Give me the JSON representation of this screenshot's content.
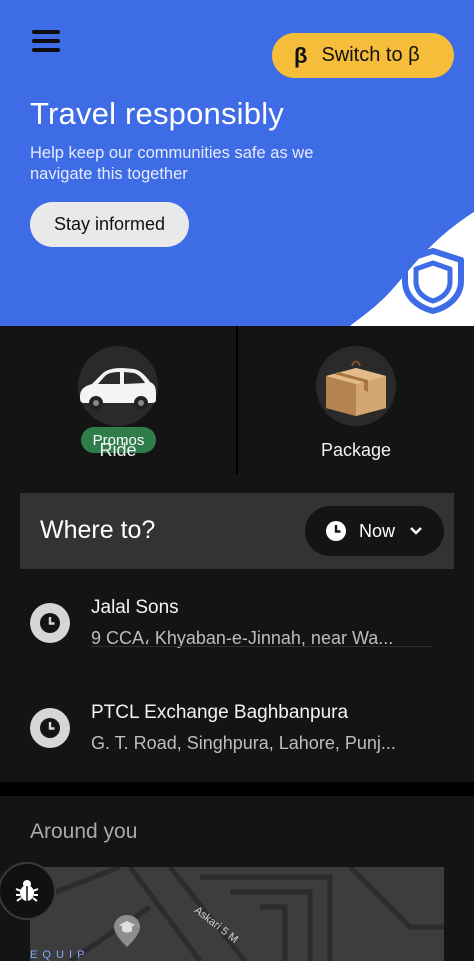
{
  "banner": {
    "switch_label": "Switch to β",
    "switch_icon_glyph": "β",
    "title": "Travel responsibly",
    "subtitle": "Help keep our communities safe as we navigate this together",
    "cta_label": "Stay informed",
    "bg_color": "#3e6be6",
    "accent_color": "#f6bd3b"
  },
  "services": [
    {
      "label": "Ride",
      "badge": "Promos",
      "icon": "car-icon"
    },
    {
      "label": "Package",
      "icon": "package-icon"
    }
  ],
  "where_to": {
    "label": "Where to?",
    "schedule_label": "Now"
  },
  "recent_places": [
    {
      "title": "Jalal Sons",
      "address": "9 CCA، Khyaban-e-Jinnah, near Wa..."
    },
    {
      "title": "PTCL Exchange Baghbanpura",
      "address": "G. T. Road, Singhpura, Lahore, Punj..."
    }
  ],
  "around_you": {
    "title": "Around you",
    "map_labels": [
      "Askari 5 M",
      "E Q U I P"
    ]
  },
  "icons": {
    "menu": "hamburger-menu-icon",
    "shield": "shield-icon",
    "clock": "clock-icon",
    "chevron": "chevron-down-icon",
    "bug": "bug-icon",
    "map_pin": "graduation-cap-pin-icon"
  }
}
